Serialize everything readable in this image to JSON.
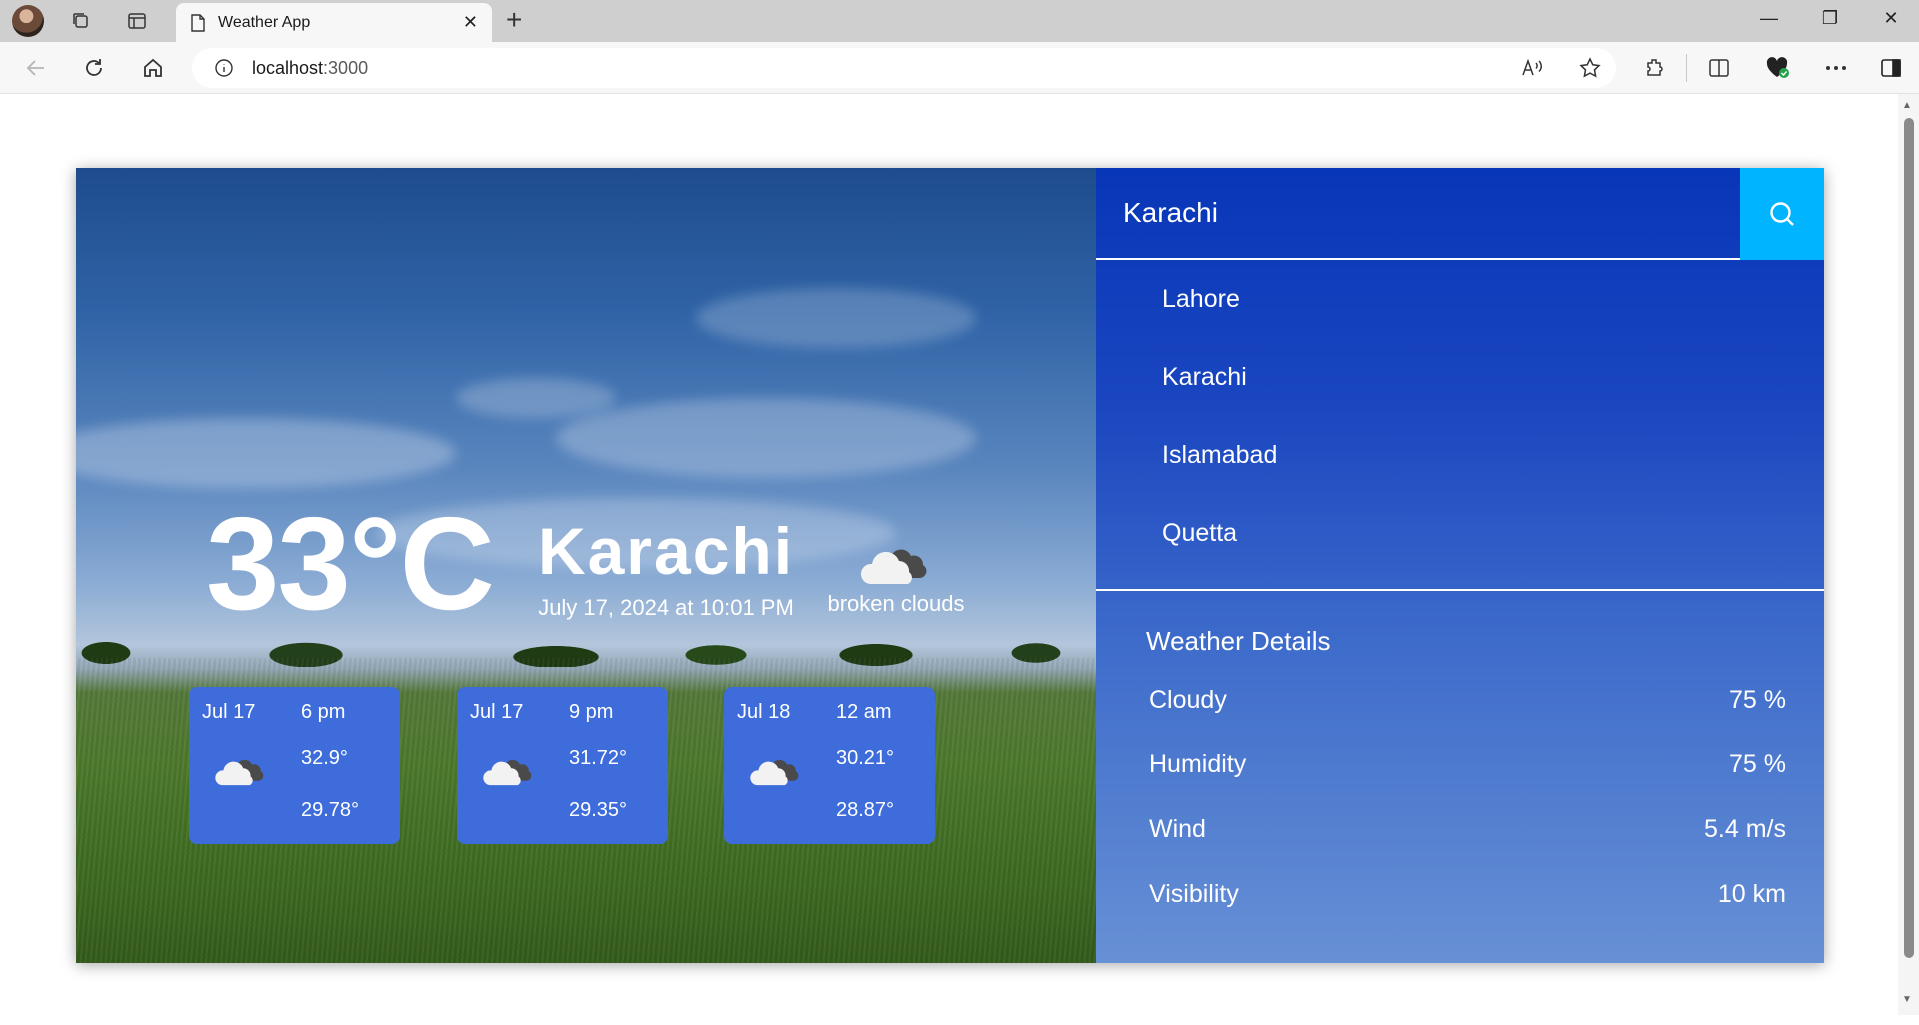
{
  "browser": {
    "tab_title": "Weather App",
    "url_host": "localhost",
    "url_port": ":3000"
  },
  "app": {
    "current": {
      "temperature": "33°C",
      "city": "Karachi",
      "datetime": "July 17, 2024 at 10:01 PM",
      "condition": "broken clouds"
    },
    "forecast": [
      {
        "date": "Jul 17",
        "time": "6 pm",
        "high": "32.9°",
        "low": "29.78°"
      },
      {
        "date": "Jul 17",
        "time": "9 pm",
        "high": "31.72°",
        "low": "29.35°"
      },
      {
        "date": "Jul 18",
        "time": "12 am",
        "high": "30.21°",
        "low": "28.87°"
      }
    ],
    "search": {
      "value": "Karachi"
    },
    "cities": [
      "Lahore",
      "Karachi",
      "Islamabad",
      "Quetta"
    ],
    "details": {
      "title": "Weather Details",
      "rows": [
        {
          "label": "Cloudy",
          "value": "75 %"
        },
        {
          "label": "Humidity",
          "value": "75 %"
        },
        {
          "label": "Wind",
          "value": "5.4 m/s"
        },
        {
          "label": "Visibility",
          "value": "10 km"
        }
      ]
    }
  },
  "colors": {
    "sidebar_top": "#0836b8",
    "sidebar_bottom": "#6790d5",
    "search_button": "#00b4ff",
    "forecast_card": "#3e6ddb"
  }
}
